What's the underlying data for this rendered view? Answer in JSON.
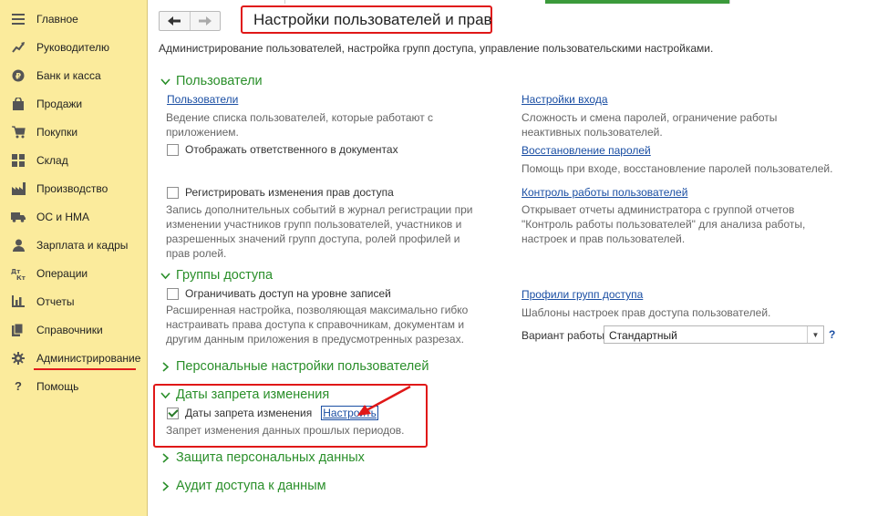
{
  "sidebar": {
    "items": [
      {
        "label": "Главное",
        "icon": "menu-icon"
      },
      {
        "label": "Руководителю",
        "icon": "chart-trend-icon"
      },
      {
        "label": "Банк и касса",
        "icon": "ruble-coin-icon"
      },
      {
        "label": "Продажи",
        "icon": "shopping-bag-icon"
      },
      {
        "label": "Покупки",
        "icon": "shopping-cart-icon"
      },
      {
        "label": "Склад",
        "icon": "warehouse-grid-icon"
      },
      {
        "label": "Производство",
        "icon": "factory-icon"
      },
      {
        "label": "ОС и НМА",
        "icon": "truck-icon"
      },
      {
        "label": "Зарплата и кадры",
        "icon": "person-icon"
      },
      {
        "label": "Операции",
        "icon": "dt-kt-icon"
      },
      {
        "label": "Отчеты",
        "icon": "bar-chart-icon"
      },
      {
        "label": "Справочники",
        "icon": "books-icon"
      },
      {
        "label": "Администрирование",
        "icon": "gear-icon"
      },
      {
        "label": "Помощь",
        "icon": "question-icon"
      }
    ],
    "active_index": 12
  },
  "header": {
    "title": "Настройки пользователей и прав",
    "description": "Администрирование пользователей, настройка групп доступа, управление пользовательскими настройками."
  },
  "sections": {
    "users": {
      "title": "Пользователи",
      "users_link": "Пользователи",
      "users_desc": "Ведение списка пользователей, которые работают с приложением.",
      "show_responsible_label": "Отображать ответственного в документах",
      "show_responsible_checked": false,
      "log_rights_label": "Регистрировать изменения прав доступа",
      "log_rights_checked": false,
      "log_rights_desc": "Запись дополнительных событий в журнал регистрации при изменении участников групп пользователей, участников и разрешенных значений групп доступа, ролей профилей и прав ролей.",
      "login_settings_link": "Настройки входа",
      "login_settings_desc": "Сложность и смена паролей, ограничение работы неактивных пользователей.",
      "password_recovery_link": "Восстановление паролей",
      "password_recovery_desc": "Помощь при входе, восстановление паролей пользователей.",
      "user_control_link": "Контроль работы пользователей",
      "user_control_desc": "Открывает отчеты администратора с группой отчетов \"Контроль работы пользователей\" для анализа работы, настроек и прав пользователей."
    },
    "access_groups": {
      "title": "Группы доступа",
      "restrict_label": "Ограничивать доступ на уровне записей",
      "restrict_checked": false,
      "restrict_desc": "Расширенная настройка, позволяющая максимально гибко настраивать права доступа к справочникам, документам и другим данным приложения в предусмотренных разрезах.",
      "profiles_link": "Профили групп доступа",
      "profiles_desc": "Шаблоны настроек прав доступа пользователей.",
      "mode_label": "Вариант работы:",
      "mode_value": "Стандартный",
      "help": "?"
    },
    "personal_settings": {
      "title": "Персональные настройки пользователей"
    },
    "closing_dates": {
      "title": "Даты запрета изменения",
      "checkbox_label": "Даты запрета изменения",
      "checked": true,
      "setup_link": "Настроить",
      "desc": "Запрет изменения данных прошлых периодов."
    },
    "personal_data": {
      "title": "Защита персональных данных"
    },
    "access_audit": {
      "title": "Аудит доступа к данным"
    }
  },
  "colors": {
    "sidebar_bg": "#fbeb9c",
    "section_title": "#2a8f2a",
    "link": "#1a4ea3",
    "highlight": "#e01818"
  }
}
